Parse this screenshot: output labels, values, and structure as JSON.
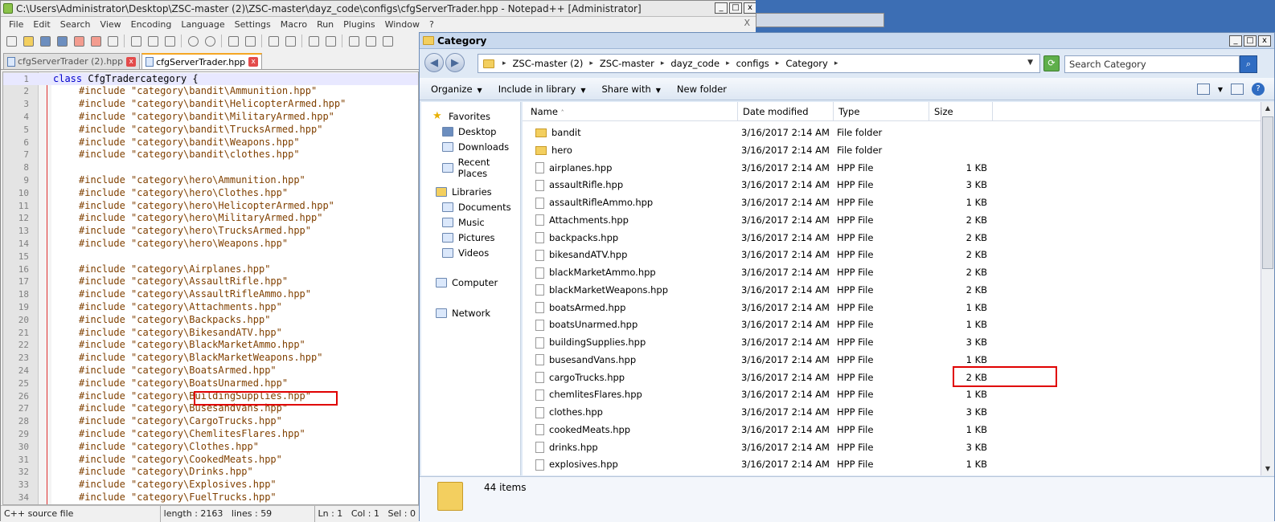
{
  "npp": {
    "title": "C:\\Users\\Administrator\\Desktop\\ZSC-master (2)\\ZSC-master\\dayz_code\\configs\\cfgServerTrader.hpp - Notepad++ [Administrator]",
    "menu": [
      "File",
      "Edit",
      "Search",
      "View",
      "Encoding",
      "Language",
      "Settings",
      "Macro",
      "Run",
      "Plugins",
      "Window",
      "?"
    ],
    "menu_close": "X",
    "tabs": [
      {
        "label": "cfgServerTrader (2).hpp"
      },
      {
        "label": "cfgServerTrader.hpp"
      }
    ],
    "lines": [
      {
        "n": "1",
        "kw": "class ",
        "rest": "CfgTradercategory {",
        "type": "class"
      },
      {
        "n": "2",
        "pp": "#include ",
        "str": "\"category\\bandit\\Ammunition.hpp\""
      },
      {
        "n": "3",
        "pp": "#include ",
        "str": "\"category\\bandit\\HelicopterArmed.hpp\""
      },
      {
        "n": "4",
        "pp": "#include ",
        "str": "\"category\\bandit\\MilitaryArmed.hpp\""
      },
      {
        "n": "5",
        "pp": "#include ",
        "str": "\"category\\bandit\\TrucksArmed.hpp\""
      },
      {
        "n": "6",
        "pp": "#include ",
        "str": "\"category\\bandit\\Weapons.hpp\""
      },
      {
        "n": "7",
        "pp": "#include ",
        "str": "\"category\\bandit\\clothes.hpp\""
      },
      {
        "n": "8",
        "pp": "",
        "str": ""
      },
      {
        "n": "9",
        "pp": "#include ",
        "str": "\"category\\hero\\Ammunition.hpp\""
      },
      {
        "n": "10",
        "pp": "#include ",
        "str": "\"category\\hero\\Clothes.hpp\""
      },
      {
        "n": "11",
        "pp": "#include ",
        "str": "\"category\\hero\\HelicopterArmed.hpp\""
      },
      {
        "n": "12",
        "pp": "#include ",
        "str": "\"category\\hero\\MilitaryArmed.hpp\""
      },
      {
        "n": "13",
        "pp": "#include ",
        "str": "\"category\\hero\\TrucksArmed.hpp\""
      },
      {
        "n": "14",
        "pp": "#include ",
        "str": "\"category\\hero\\Weapons.hpp\""
      },
      {
        "n": "15",
        "pp": "",
        "str": ""
      },
      {
        "n": "16",
        "pp": "#include ",
        "str": "\"category\\Airplanes.hpp\""
      },
      {
        "n": "17",
        "pp": "#include ",
        "str": "\"category\\AssaultRifle.hpp\""
      },
      {
        "n": "18",
        "pp": "#include ",
        "str": "\"category\\AssaultRifleAmmo.hpp\""
      },
      {
        "n": "19",
        "pp": "#include ",
        "str": "\"category\\Attachments.hpp\""
      },
      {
        "n": "20",
        "pp": "#include ",
        "str": "\"category\\Backpacks.hpp\""
      },
      {
        "n": "21",
        "pp": "#include ",
        "str": "\"category\\BikesandATV.hpp\""
      },
      {
        "n": "22",
        "pp": "#include ",
        "str": "\"category\\BlackMarketAmmo.hpp\""
      },
      {
        "n": "23",
        "pp": "#include ",
        "str": "\"category\\BlackMarketWeapons.hpp\""
      },
      {
        "n": "24",
        "pp": "#include ",
        "str": "\"category\\BoatsArmed.hpp\""
      },
      {
        "n": "25",
        "pp": "#include ",
        "str": "\"category\\BoatsUnarmed.hpp\""
      },
      {
        "n": "26",
        "pp": "#include ",
        "str": "\"category\\BuildingSupplies.hpp\""
      },
      {
        "n": "27",
        "pp": "#include ",
        "str": "\"category\\BusesandVans.hpp\""
      },
      {
        "n": "28",
        "pp": "#include ",
        "str": "\"category\\CargoTrucks.hpp\""
      },
      {
        "n": "29",
        "pp": "#include ",
        "str": "\"category\\ChemlitesFlares.hpp\""
      },
      {
        "n": "30",
        "pp": "#include ",
        "str": "\"category\\Clothes.hpp\""
      },
      {
        "n": "31",
        "pp": "#include ",
        "str": "\"category\\CookedMeats.hpp\""
      },
      {
        "n": "32",
        "pp": "#include ",
        "str": "\"category\\Drinks.hpp\""
      },
      {
        "n": "33",
        "pp": "#include ",
        "str": "\"category\\Explosives.hpp\""
      },
      {
        "n": "34",
        "pp": "#include ",
        "str": "\"category\\FuelTrucks.hpp\""
      }
    ],
    "status": {
      "type": "C++ source file",
      "length": "length : 2163",
      "lines": "lines : 59",
      "ln": "Ln : 1",
      "col": "Col : 1",
      "sel": "Sel : 0"
    }
  },
  "explorer": {
    "title": "Category",
    "breadcrumb": [
      "ZSC-master (2)",
      "ZSC-master",
      "dayz_code",
      "configs",
      "Category"
    ],
    "search_placeholder": "Search Category",
    "commands": [
      {
        "label": "Organize",
        "dd": true
      },
      {
        "label": "Include in library",
        "dd": true
      },
      {
        "label": "Share with",
        "dd": true
      },
      {
        "label": "New folder",
        "dd": false
      }
    ],
    "nav": {
      "favorites": "Favorites",
      "desktop": "Desktop",
      "downloads": "Downloads",
      "recent": "Recent Places",
      "libraries": "Libraries",
      "documents": "Documents",
      "music": "Music",
      "pictures": "Pictures",
      "videos": "Videos",
      "computer": "Computer",
      "network": "Network"
    },
    "columns": {
      "name": "Name",
      "date": "Date modified",
      "type": "Type",
      "size": "Size"
    },
    "files": [
      {
        "name": "bandit",
        "date": "3/16/2017 2:14 AM",
        "type": "File folder",
        "size": "",
        "folder": true
      },
      {
        "name": "hero",
        "date": "3/16/2017 2:14 AM",
        "type": "File folder",
        "size": "",
        "folder": true
      },
      {
        "name": "airplanes.hpp",
        "date": "3/16/2017 2:14 AM",
        "type": "HPP File",
        "size": "1 KB"
      },
      {
        "name": "assaultRifle.hpp",
        "date": "3/16/2017 2:14 AM",
        "type": "HPP File",
        "size": "3 KB"
      },
      {
        "name": "assaultRifleAmmo.hpp",
        "date": "3/16/2017 2:14 AM",
        "type": "HPP File",
        "size": "1 KB"
      },
      {
        "name": "Attachments.hpp",
        "date": "3/16/2017 2:14 AM",
        "type": "HPP File",
        "size": "2 KB"
      },
      {
        "name": "backpacks.hpp",
        "date": "3/16/2017 2:14 AM",
        "type": "HPP File",
        "size": "2 KB"
      },
      {
        "name": "bikesandATV.hpp",
        "date": "3/16/2017 2:14 AM",
        "type": "HPP File",
        "size": "2 KB"
      },
      {
        "name": "blackMarketAmmo.hpp",
        "date": "3/16/2017 2:14 AM",
        "type": "HPP File",
        "size": "2 KB"
      },
      {
        "name": "blackMarketWeapons.hpp",
        "date": "3/16/2017 2:14 AM",
        "type": "HPP File",
        "size": "2 KB"
      },
      {
        "name": "boatsArmed.hpp",
        "date": "3/16/2017 2:14 AM",
        "type": "HPP File",
        "size": "1 KB"
      },
      {
        "name": "boatsUnarmed.hpp",
        "date": "3/16/2017 2:14 AM",
        "type": "HPP File",
        "size": "1 KB"
      },
      {
        "name": "buildingSupplies.hpp",
        "date": "3/16/2017 2:14 AM",
        "type": "HPP File",
        "size": "3 KB"
      },
      {
        "name": "busesandVans.hpp",
        "date": "3/16/2017 2:14 AM",
        "type": "HPP File",
        "size": "1 KB"
      },
      {
        "name": "cargoTrucks.hpp",
        "date": "3/16/2017 2:14 AM",
        "type": "HPP File",
        "size": "2 KB"
      },
      {
        "name": "chemlitesFlares.hpp",
        "date": "3/16/2017 2:14 AM",
        "type": "HPP File",
        "size": "1 KB"
      },
      {
        "name": "clothes.hpp",
        "date": "3/16/2017 2:14 AM",
        "type": "HPP File",
        "size": "3 KB"
      },
      {
        "name": "cookedMeats.hpp",
        "date": "3/16/2017 2:14 AM",
        "type": "HPP File",
        "size": "1 KB"
      },
      {
        "name": "drinks.hpp",
        "date": "3/16/2017 2:14 AM",
        "type": "HPP File",
        "size": "3 KB"
      },
      {
        "name": "explosives.hpp",
        "date": "3/16/2017 2:14 AM",
        "type": "HPP File",
        "size": "1 KB"
      }
    ],
    "items_count": "44 items"
  },
  "colors": {
    "highlight": "#e00000",
    "keyword": "#0000cc",
    "preproc": "#804000",
    "string": "#808080"
  }
}
